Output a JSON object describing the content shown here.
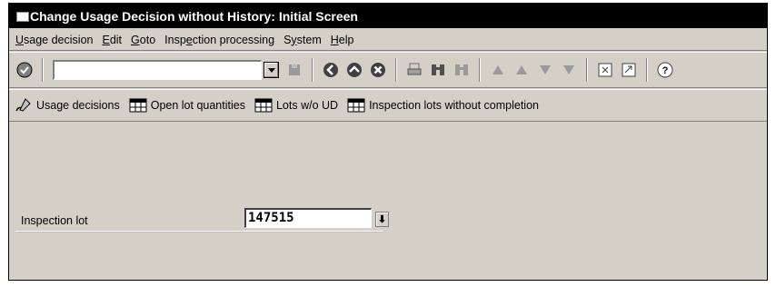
{
  "window": {
    "title": "Change Usage Decision without History: Initial Screen"
  },
  "menubar": {
    "items": [
      {
        "pre": "",
        "u": "U",
        "post": "sage decision"
      },
      {
        "pre": "",
        "u": "E",
        "post": "dit"
      },
      {
        "pre": "",
        "u": "G",
        "post": "oto"
      },
      {
        "pre": "Insp",
        "u": "e",
        "post": "ction processing"
      },
      {
        "pre": "S",
        "u": "y",
        "post": "stem"
      },
      {
        "pre": "",
        "u": "H",
        "post": "elp"
      }
    ]
  },
  "toolbar": {
    "command_field_value": ""
  },
  "appbar": {
    "buttons": [
      {
        "label": "Usage decisions"
      },
      {
        "label": "Open lot quantities"
      },
      {
        "label": "Lots w/o UD"
      },
      {
        "label": "Inspection lots without completion"
      }
    ]
  },
  "form": {
    "inspection_lot_label": "Inspection lot",
    "inspection_lot_value": "147515",
    "f4_glyph": "⬇"
  }
}
